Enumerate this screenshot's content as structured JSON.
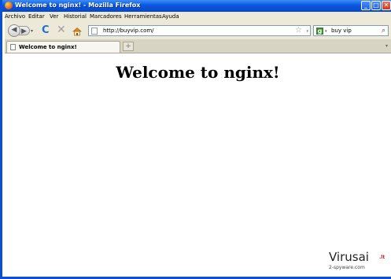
{
  "window": {
    "title": "Welcome to nginx! - Mozilla Firefox",
    "buttons": {
      "minimize": "_",
      "maximize": "□",
      "close": "✕"
    }
  },
  "menu": [
    "Archivo",
    "Editar",
    "Ver",
    "Historial",
    "Marcadores",
    "Herramientas",
    "Ayuda"
  ],
  "navigation": {
    "back_icon": "◀",
    "forward_icon": "▶",
    "reload_icon": "C",
    "stop_icon": "✕",
    "url": "http://buyvip.com/",
    "bookmark_icon": "☆",
    "dropdown_icon": "▾"
  },
  "search": {
    "engine_icon": "g",
    "value": "buy vip",
    "magnifier_icon": "⌕"
  },
  "tabs": [
    {
      "label": "Welcome to nginx!",
      "close": "✕"
    }
  ],
  "new_tab": "+",
  "page": {
    "heading": "Welcome to nginx!"
  },
  "watermark": {
    "main": "Virusai",
    "suffix": ".lt",
    "sub": "2-spyware.com"
  }
}
